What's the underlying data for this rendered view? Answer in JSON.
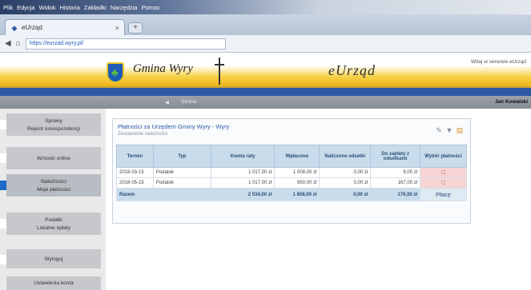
{
  "browser": {
    "menu": [
      "Plik",
      "Edycja",
      "Widok",
      "Historia",
      "Zakładki",
      "Narzędzia",
      "Pomoc"
    ],
    "tab_title": "eUrząd",
    "tab_close": "×",
    "new_tab": "+",
    "url": "https://eurzad.wyry.pl/",
    "back": "◀",
    "home": "⌂"
  },
  "header": {
    "gmina_title": "Gmina Wyry",
    "brand": "eUrząd",
    "right_text": "Witaj w serwisie eUrząd"
  },
  "nav": {
    "items": [
      "◀",
      "Strona"
    ],
    "user": "Jan Kowalski"
  },
  "sidebar": {
    "items": [
      {
        "lines": [
          "Sprawy",
          "Rejestr korespondencji"
        ]
      },
      {
        "lines": [
          "Wnioski online"
        ]
      },
      {
        "lines": [
          "Należności",
          "Moje płatności"
        ],
        "active": true
      },
      {
        "lines": [
          "Podatki",
          "Lokalne opłaty"
        ]
      },
      {
        "lines": [
          "Wyloguj"
        ]
      },
      {
        "lines": [
          "Ustawienia konta"
        ]
      }
    ]
  },
  "panel": {
    "title": "Płatności za Urzędem Gminy Wyry - Wyry",
    "subtitle": "Zestawienie należności",
    "icons": [
      "✎",
      "▼",
      "▤"
    ]
  },
  "table": {
    "headers": [
      "Termin",
      "Typ",
      "Kwota raty",
      "Wpłacono",
      "Naliczone odsetki",
      "Do zapłaty z odsetkami",
      "Wybór płatności"
    ],
    "rows": [
      [
        "2018-03-15",
        "Podatek",
        "1 017,00 zł",
        "1 008,00 zł",
        "0,00 zł",
        "9,00 zł",
        "☐"
      ],
      [
        "2018-05-15",
        "Podatek",
        "1 017,00 zł",
        "850,00 zł",
        "0,00 zł",
        "167,00 zł",
        "☐"
      ]
    ],
    "summary": [
      "Razem",
      "",
      "2 034,00 zł",
      "1 858,00 zł",
      "0,00 zł",
      "176,00 zł",
      "Płacę"
    ]
  },
  "colors": {
    "header_blue": "#2e57a4",
    "header_yellow": "#f1b71c",
    "table_header": "#c8dcec",
    "action_cell": "#f6d5d5",
    "sidebar_active_marker": "#1b6ac9"
  }
}
